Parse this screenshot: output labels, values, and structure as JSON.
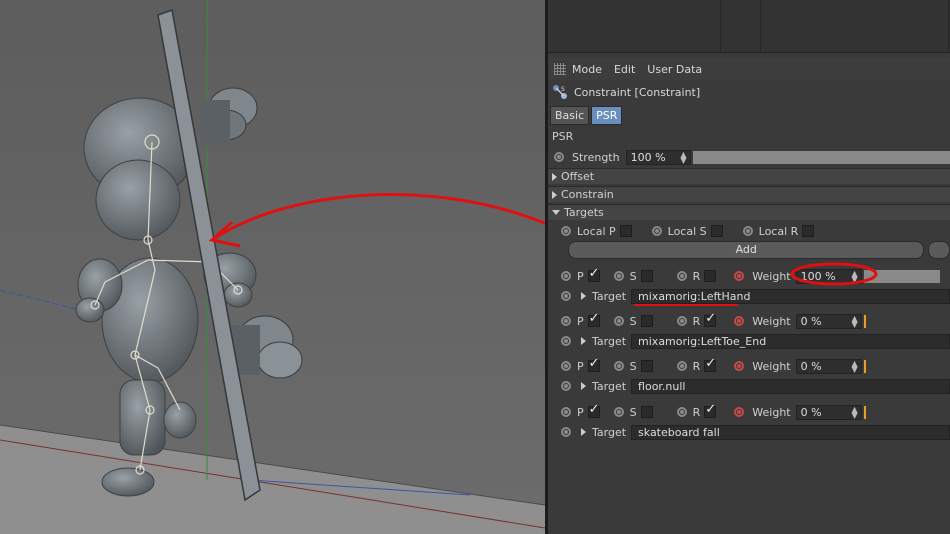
{
  "menu": {
    "items": [
      "Mode",
      "Edit",
      "User Data"
    ]
  },
  "object": {
    "title": "Constraint [Constraint]"
  },
  "tabs": [
    {
      "label": "Basic",
      "active": false
    },
    {
      "label": "PSR",
      "active": true
    }
  ],
  "section": {
    "title": "PSR"
  },
  "strength": {
    "label": "Strength",
    "value": "100 %",
    "fraction": 1.0
  },
  "groups": {
    "offset": "Offset",
    "constrain": "Constrain",
    "targets": "Targets"
  },
  "local": {
    "p": "Local P",
    "s": "Local S",
    "r": "Local R"
  },
  "add_label": "Add",
  "col_labels": {
    "p": "P",
    "s": "S",
    "r": "R",
    "weight": "Weight",
    "target": "Target"
  },
  "targets": [
    {
      "p": true,
      "s": false,
      "r": false,
      "weight": "100 %",
      "weight_fraction": 1.0,
      "target": "mixamorig:LeftHand"
    },
    {
      "p": true,
      "s": false,
      "r": true,
      "weight": "0 %",
      "weight_fraction": 0.0,
      "target": "mixamorig:LeftToe_End"
    },
    {
      "p": true,
      "s": false,
      "r": true,
      "weight": "0 %",
      "weight_fraction": 0.0,
      "target": "floor.null"
    },
    {
      "p": true,
      "s": false,
      "r": true,
      "weight": "0 %",
      "weight_fraction": 0.0,
      "target": "skateboard fall"
    }
  ],
  "colors": {
    "annotation": "#e01010",
    "accent": "#6a8fbf",
    "weight_marker": "#e89e2c"
  }
}
